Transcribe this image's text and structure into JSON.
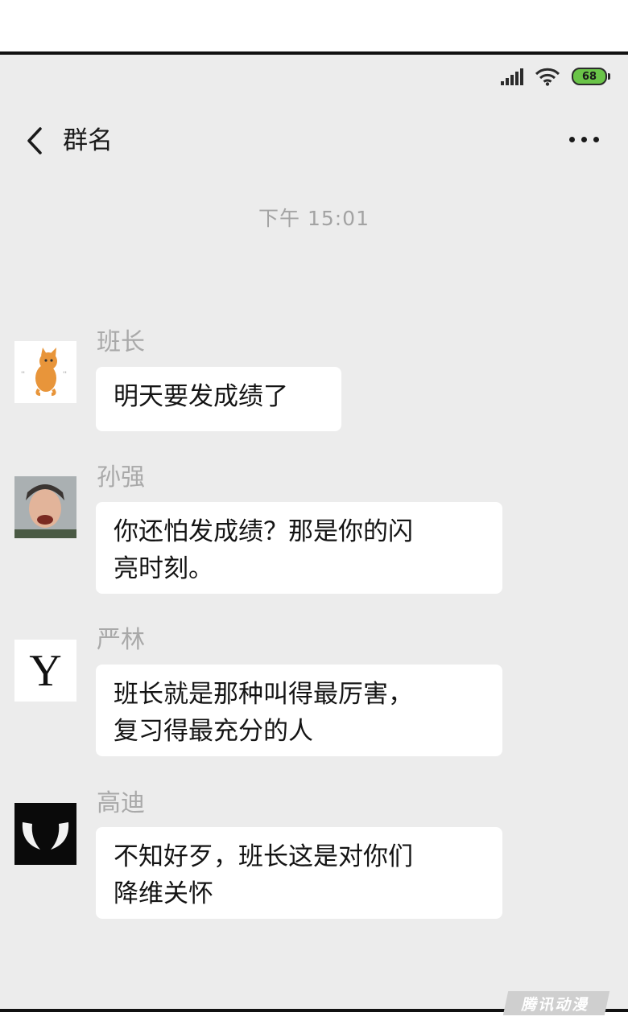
{
  "status": {
    "battery": "68"
  },
  "nav": {
    "title": "群名"
  },
  "timestamp": "下午 15:01",
  "messages": [
    {
      "sender": "班长",
      "text": "明天要发成绩了"
    },
    {
      "sender": "孙强",
      "text": "你还怕发成绩？那是你的闪\n亮时刻。"
    },
    {
      "sender": "严林",
      "text": "班长就是那种叫得最厉害，\n复习得最充分的人",
      "avatar_letter": "Y"
    },
    {
      "sender": "高迪",
      "text": "不知好歹，班长这是对你们\n降维关怀"
    }
  ],
  "watermark": "腾讯动漫",
  "colors": {
    "chat_bg": "#ececec",
    "bubble": "#ffffff",
    "battery": "#6ac448"
  }
}
